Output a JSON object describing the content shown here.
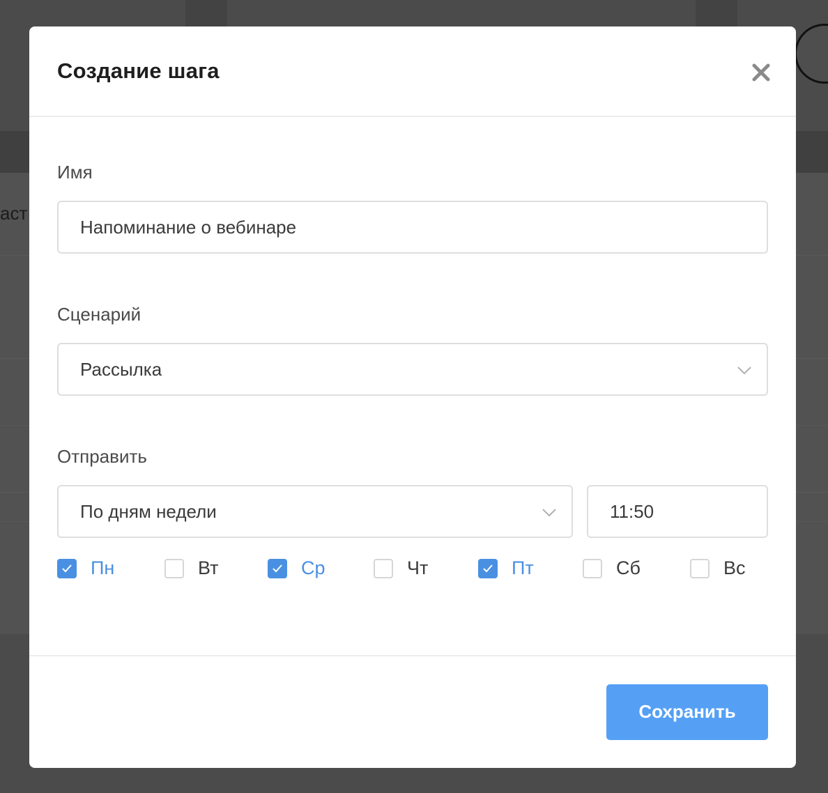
{
  "background": {
    "partial_text": "аст"
  },
  "modal": {
    "title": "Создание шага",
    "close_icon": "close-icon",
    "name_field": {
      "label": "Имя",
      "value": "Напоминание о вебинаре"
    },
    "scenario_field": {
      "label": "Сценарий",
      "value": "Рассылка",
      "icon": "chevron-down-icon"
    },
    "send_field": {
      "label": "Отправить",
      "mode": "По дням недели",
      "mode_icon": "chevron-down-icon",
      "time": "11:50"
    },
    "weekdays": [
      {
        "label": "Пн",
        "checked": true
      },
      {
        "label": "Вт",
        "checked": false
      },
      {
        "label": "Ср",
        "checked": true
      },
      {
        "label": "Чт",
        "checked": false
      },
      {
        "label": "Пт",
        "checked": true
      },
      {
        "label": "Сб",
        "checked": false
      },
      {
        "label": "Вс",
        "checked": false
      }
    ],
    "save_label": "Сохранить"
  },
  "colors": {
    "accent": "#4a90e2",
    "button": "#55a0f5",
    "overlay": "#4b4b4b"
  }
}
